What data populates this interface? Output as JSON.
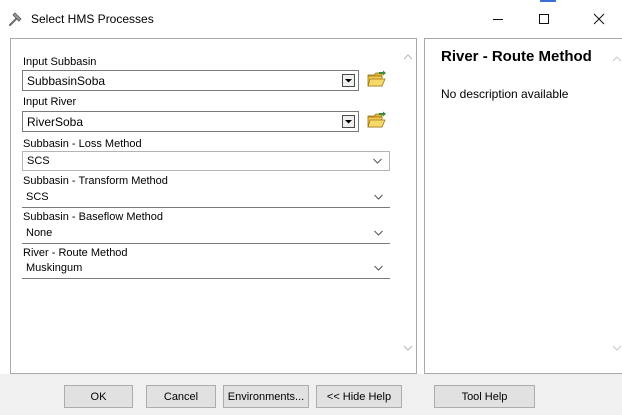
{
  "window": {
    "title": "Select HMS Processes",
    "minimize_glyph": "—",
    "maximize_glyph": "☐",
    "close_glyph": "✕"
  },
  "form": {
    "input_subbasin": {
      "label": "Input Subbasin",
      "value": "SubbasinSoba"
    },
    "input_river": {
      "label": "Input River",
      "value": "RiverSoba"
    },
    "loss_method": {
      "label": "Subbasin - Loss Method",
      "value": "SCS"
    },
    "transform_method": {
      "label": "Subbasin - Transform Method",
      "value": "SCS"
    },
    "baseflow_method": {
      "label": "Subbasin - Baseflow Method",
      "value": "None"
    },
    "route_method": {
      "label": "River - Route Method",
      "value": "Muskingum"
    }
  },
  "help": {
    "title": "River - Route Method",
    "description": "No description available"
  },
  "buttons": {
    "ok": "OK",
    "cancel": "Cancel",
    "environments": "Environments...",
    "hide_help": "<< Hide Help",
    "tool_help": "Tool Help"
  },
  "colors": {
    "folder_yellow": "#f2c94c",
    "folder_outline": "#b8860b",
    "window_bg": "#f0f0f0",
    "border": "#a9a9a9"
  },
  "icons": {
    "app": "hammer-icon",
    "dropdown": "dropdown-arrow-icon",
    "browse": "open-folder-icon",
    "select": "chevron-down-icon"
  }
}
